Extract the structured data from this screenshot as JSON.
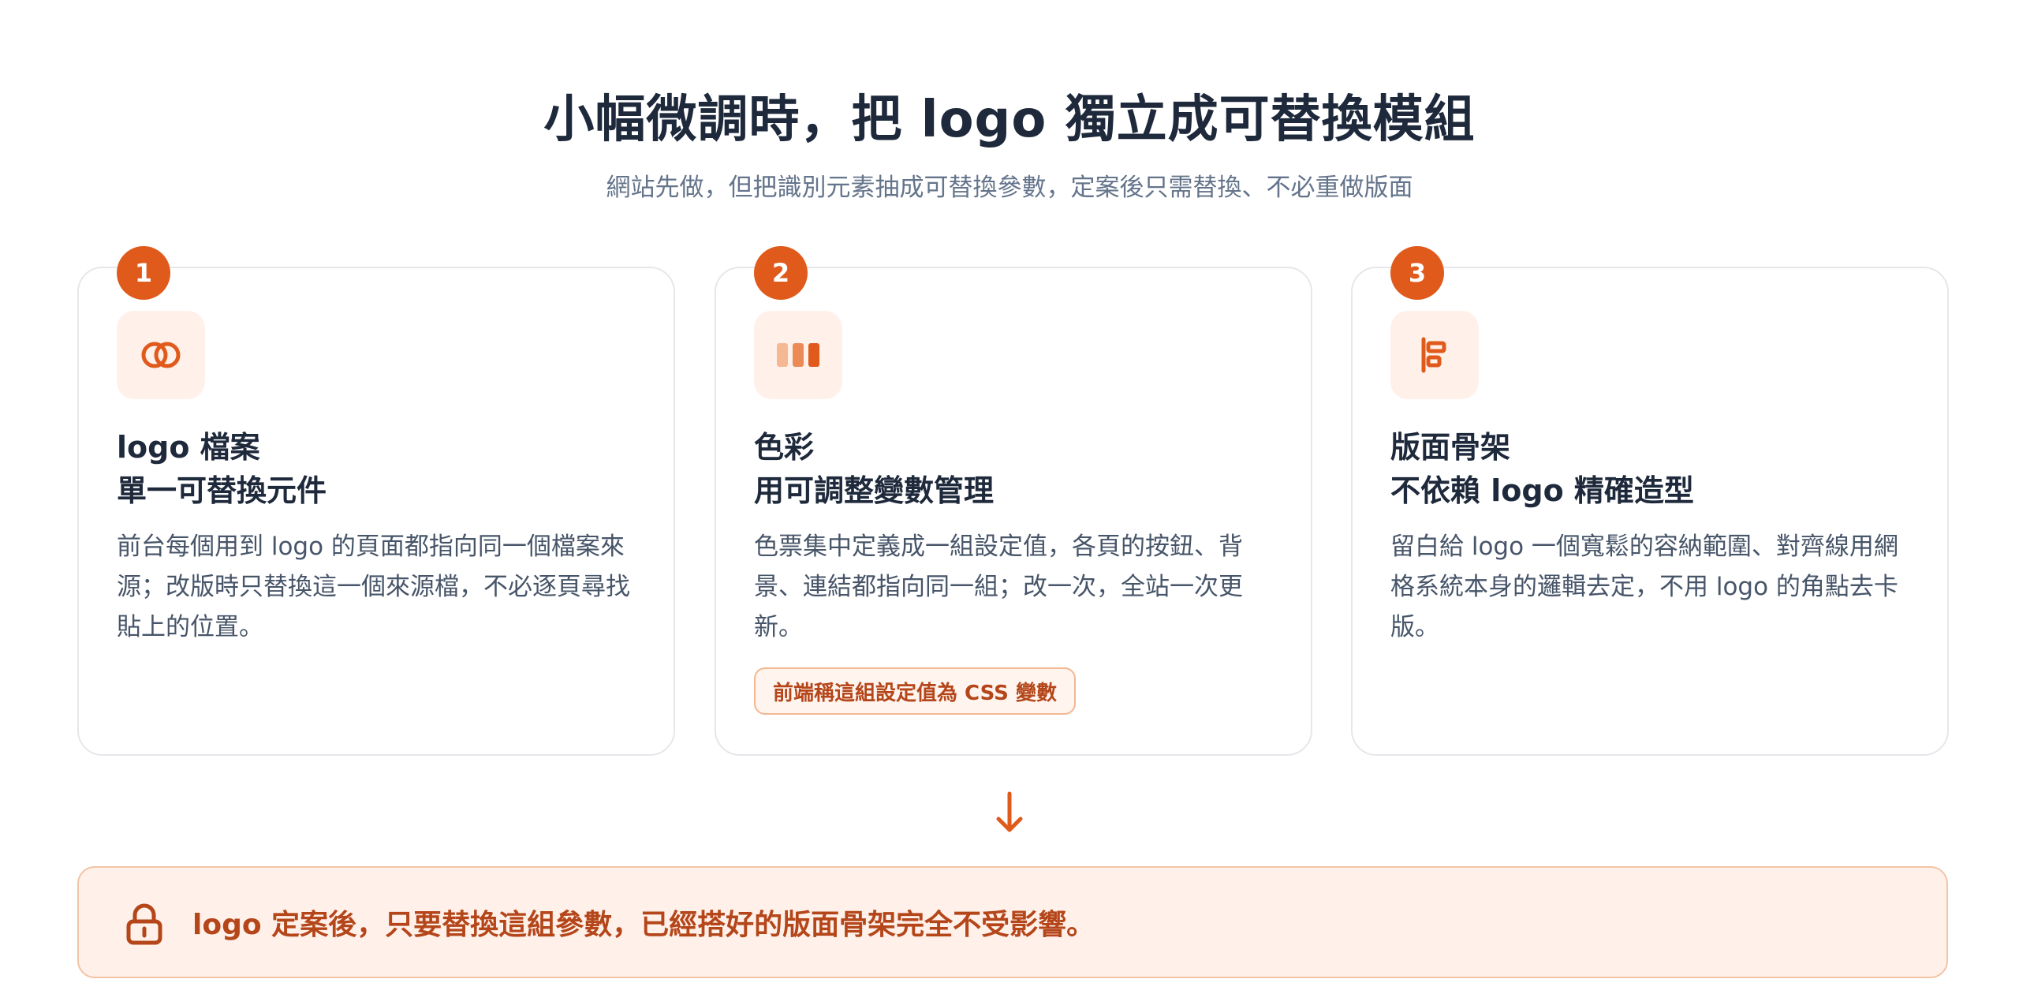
{
  "header": {
    "title": "小幅微調時，把 logo 獨立成可替換模組",
    "subtitle": "網站先做，但把識別元素抽成可替換參數，定案後只需替換、不必重做版面"
  },
  "colors": {
    "accent": "#e05a1c",
    "accent_soft": "#fff1ea",
    "accent_text": "#b4461a",
    "heading": "#1e293b",
    "muted": "#64748b"
  },
  "cards": [
    {
      "step": "1",
      "icon": "linked-rings-icon",
      "heading_line1": "logo 檔案",
      "heading_line2": "單一可替換元件",
      "body": "前台每個用到 logo 的頁面都指向同一個檔案來源；改版時只替換這一個來源檔，不必逐頁尋找貼上的位置。"
    },
    {
      "step": "2",
      "icon": "color-swatches-icon",
      "heading_line1": "色彩",
      "heading_line2": "用可調整變數管理",
      "body": "色票集中定義成一組設定值，各頁的按鈕、背景、連結都指向同一組；改一次，全站一次更新。",
      "tag": "前端稱這組設定值為 CSS 變數"
    },
    {
      "step": "3",
      "icon": "layout-align-icon",
      "heading_line1": "版面骨架",
      "heading_line2": "不依賴 logo 精確造型",
      "body": "留白給 logo 一個寬鬆的容納範圍、對齊線用網格系統本身的邏輯去定，不用 logo 的角點去卡版。"
    }
  ],
  "flow_icon": "arrow-down-icon",
  "banner": {
    "icon": "lock-icon",
    "text": "logo 定案後，只要替換這組參數，已經搭好的版面骨架完全不受影響。"
  }
}
